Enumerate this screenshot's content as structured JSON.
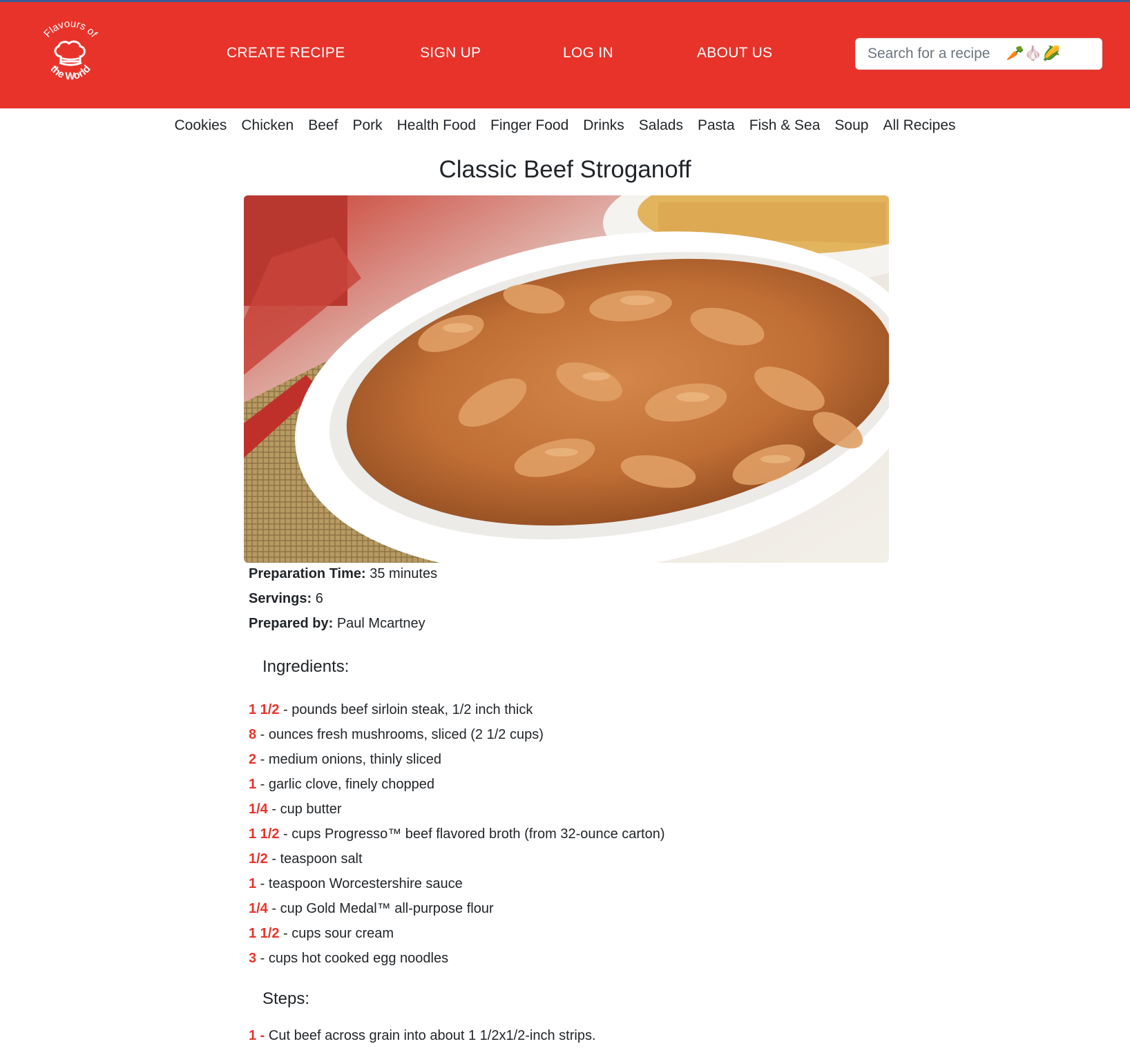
{
  "brand": {
    "logo_text_top": "Flavours of",
    "logo_text_bottom": "the World",
    "header_color": "#e8332a"
  },
  "nav": {
    "create_recipe": "CREATE RECIPE",
    "sign_up": "SIGN UP",
    "log_in": "LOG IN",
    "about_us": "ABOUT US"
  },
  "search": {
    "placeholder": "Search for a recipe    🥕🧄🌽"
  },
  "categories": [
    "Cookies",
    "Chicken",
    "Beef",
    "Pork",
    "Health Food",
    "Finger Food",
    "Drinks",
    "Salads",
    "Pasta",
    "Fish & Sea",
    "Soup",
    "All Recipes"
  ],
  "recipe": {
    "title": "Classic Beef Stroganoff",
    "image_alt": "beef-stroganoff-photo",
    "prep_label": "Preparation Time:",
    "prep_value": "35 minutes",
    "servings_label": "Servings:",
    "servings_value": "6",
    "prepared_by_label": "Prepared by:",
    "prepared_by_value": "Paul Mcartney",
    "ingredients_heading": "Ingredients:",
    "ingredients": [
      {
        "qty": "1 1/2",
        "text": " - pounds beef sirloin steak, 1/2 inch thick"
      },
      {
        "qty": "8",
        "text": " - ounces fresh mushrooms, sliced (2 1/2 cups)"
      },
      {
        "qty": "2",
        "text": " - medium onions, thinly sliced"
      },
      {
        "qty": "1",
        "text": " - garlic clove, finely chopped"
      },
      {
        "qty": "1/4",
        "text": " - cup butter"
      },
      {
        "qty": "1 1/2",
        "text": " - cups Progresso™ beef flavored broth (from 32-ounce carton)"
      },
      {
        "qty": "1/2",
        "text": " - teaspoon salt"
      },
      {
        "qty": "1",
        "text": " - teaspoon Worcestershire sauce"
      },
      {
        "qty": "1/4",
        "text": " - cup Gold Medal™ all-purpose flour"
      },
      {
        "qty": "1 1/2",
        "text": " - cups sour cream"
      },
      {
        "qty": "3",
        "text": " - cups hot cooked egg noodles"
      }
    ],
    "steps_heading": "Steps:",
    "steps": [
      {
        "num": "1 - ",
        "text": "Cut beef across grain into about 1 1/2x1/2-inch strips."
      }
    ]
  }
}
